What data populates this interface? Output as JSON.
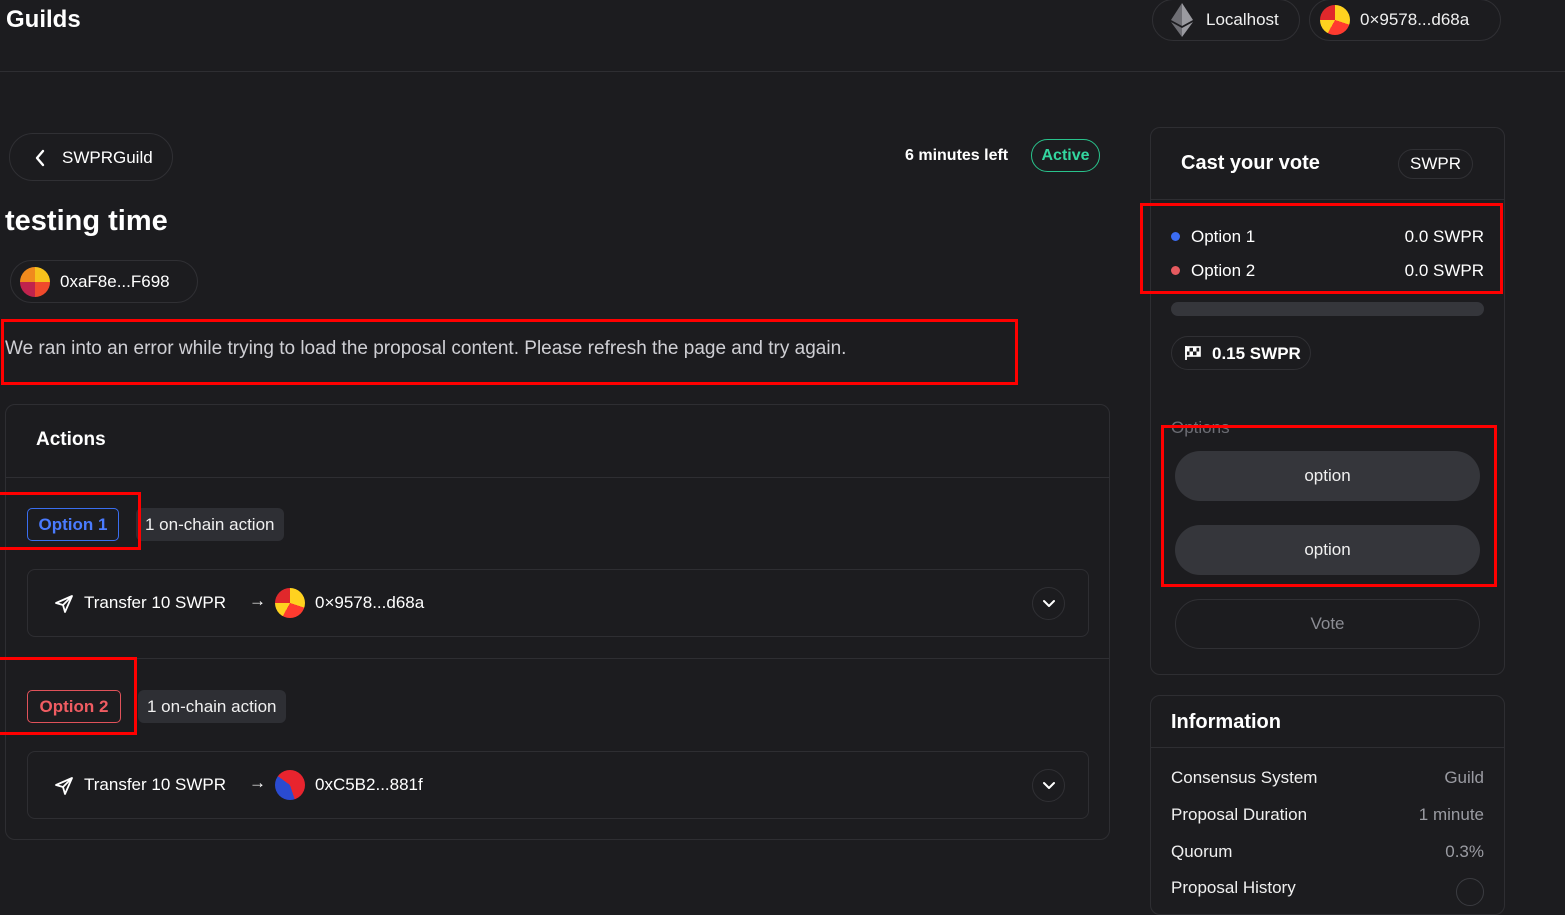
{
  "header": {
    "brand": "Guilds",
    "network_label": "Localhost",
    "account_address": "0×9578...d68a"
  },
  "proposal": {
    "guild_name": "SWPRGuild",
    "time_left": "6 minutes left",
    "status": "Active",
    "title": "testing time",
    "author_address": "0xaF8e...F698",
    "error_message": "We ran into an error while trying to load the proposal content. Please refresh the page and try again."
  },
  "actions": {
    "title": "Actions",
    "groups": [
      {
        "option_label": "Option 1",
        "count_label": "1 on-chain action",
        "action_label": "Transfer 10 SWPR",
        "arrow": "→",
        "recipient": "0×9578...d68a"
      },
      {
        "option_label": "Option 2",
        "count_label": "1 on-chain action",
        "action_label": "Transfer 10 SWPR",
        "arrow": "→",
        "recipient": "0xC5B2...881f"
      }
    ]
  },
  "vote": {
    "title": "Cast your vote",
    "token": "SWPR",
    "results": [
      {
        "name": "Option 1",
        "value": "0.0 SWPR",
        "color": "#3b6cf2"
      },
      {
        "name": "Option 2",
        "value": "0.0 SWPR",
        "color": "#e65a5f"
      }
    ],
    "progress": 0,
    "quorum": "0.15 SWPR",
    "options_label": "Options",
    "option_buttons": [
      "option",
      "option"
    ],
    "vote_button": "Vote"
  },
  "information": {
    "title": "Information",
    "rows": [
      {
        "key": "Consensus System",
        "value": "Guild"
      },
      {
        "key": "Proposal Duration",
        "value": "1 minute"
      },
      {
        "key": "Quorum",
        "value": "0.3%"
      },
      {
        "key": "Proposal History",
        "value": ""
      }
    ]
  },
  "colors": {
    "background": "#1c1c1f",
    "active_green": "#33d69f",
    "option1_blue": "#4a7bff",
    "option2_red": "#f05c62",
    "highlight": "#ff0000"
  },
  "icons": [
    "ethereum-icon",
    "chevron-left-icon",
    "send-icon",
    "arrow-right-icon",
    "chevron-down-icon",
    "flag-icon"
  ]
}
